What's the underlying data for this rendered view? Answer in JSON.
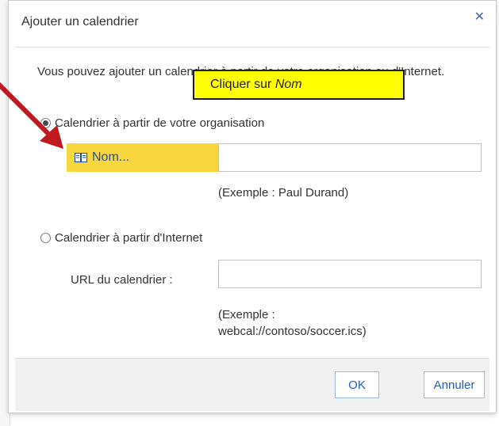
{
  "dialog": {
    "title": "Ajouter un calendrier",
    "close_glyph": "✕",
    "intro": "Vous pouvez ajouter un calendrier à partir de votre organisation ou d'Internet.",
    "org_option": {
      "label": "Calendrier à partir de votre organisation",
      "selected": true,
      "name_button_label": "Nom...",
      "name_input_value": "",
      "example": "(Exemple : Paul Durand)"
    },
    "internet_option": {
      "label": "Calendrier à partir d'Internet",
      "selected": false,
      "url_label": "URL du calendrier :",
      "url_input_value": "",
      "example_line1": "(Exemple :",
      "example_line2": "webcal://contoso/soccer.ics)"
    },
    "footer": {
      "ok_label": "OK",
      "cancel_label": "Annuler"
    }
  },
  "callout": {
    "prefix": "Cliquer sur ",
    "emphasis": "Nom"
  },
  "colors": {
    "highlight": "#f8d63e",
    "callout": "#ffff00",
    "arrow": "#c0181f",
    "link_blue": "#1f5fb6"
  },
  "icons": {
    "name_button": "address-book-icon",
    "close": "close-icon"
  }
}
